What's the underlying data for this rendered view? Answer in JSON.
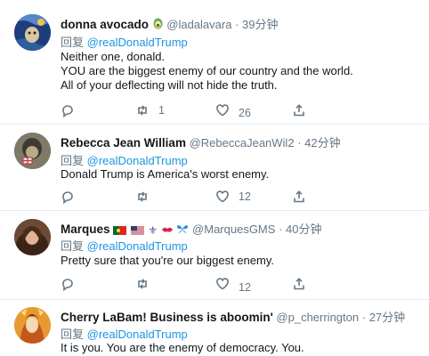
{
  "tweets": [
    {
      "name": "donna avocado",
      "handle": "@ladalavara",
      "time": "39分钟",
      "reply_prefix": "回复",
      "reply_to": "@realDonaldTrump",
      "lines": [
        "Neither one, donald.",
        "YOU are the biggest enemy of our country and the world.",
        "All of your deflecting will not hide the truth."
      ],
      "retweets": "1",
      "likes": "26"
    },
    {
      "name": "Rebecca Jean William",
      "handle": "@RebeccaJeanWil2",
      "time": "42分钟",
      "reply_prefix": "回复",
      "reply_to": "@realDonaldTrump",
      "lines": [
        "Donald Trump is America's worst enemy."
      ],
      "retweets": "",
      "likes": "12"
    },
    {
      "name": "Marques",
      "handle": "@MarquesGMS",
      "time": "40分钟",
      "reply_prefix": "回复",
      "reply_to": "@realDonaldTrump",
      "lines": [
        "Pretty sure that you're our biggest enemy."
      ],
      "retweets": "",
      "likes": "12"
    },
    {
      "name": "Cherry LaBam! Business is aboomin'",
      "handle": "@p_cherrington",
      "time": "27分钟",
      "reply_prefix": "回复",
      "reply_to": "@realDonaldTrump",
      "lines": [
        "It is you. You are the enemy of democracy. You."
      ]
    }
  ],
  "separator": "·",
  "icons": {
    "reply": "reply-icon",
    "retweet": "retweet-icon",
    "like": "heart-icon",
    "share": "share-icon"
  },
  "colors": {
    "link": "#1b95e0",
    "muted": "#657786",
    "text": "#14171a",
    "border": "#e6ecf0"
  }
}
